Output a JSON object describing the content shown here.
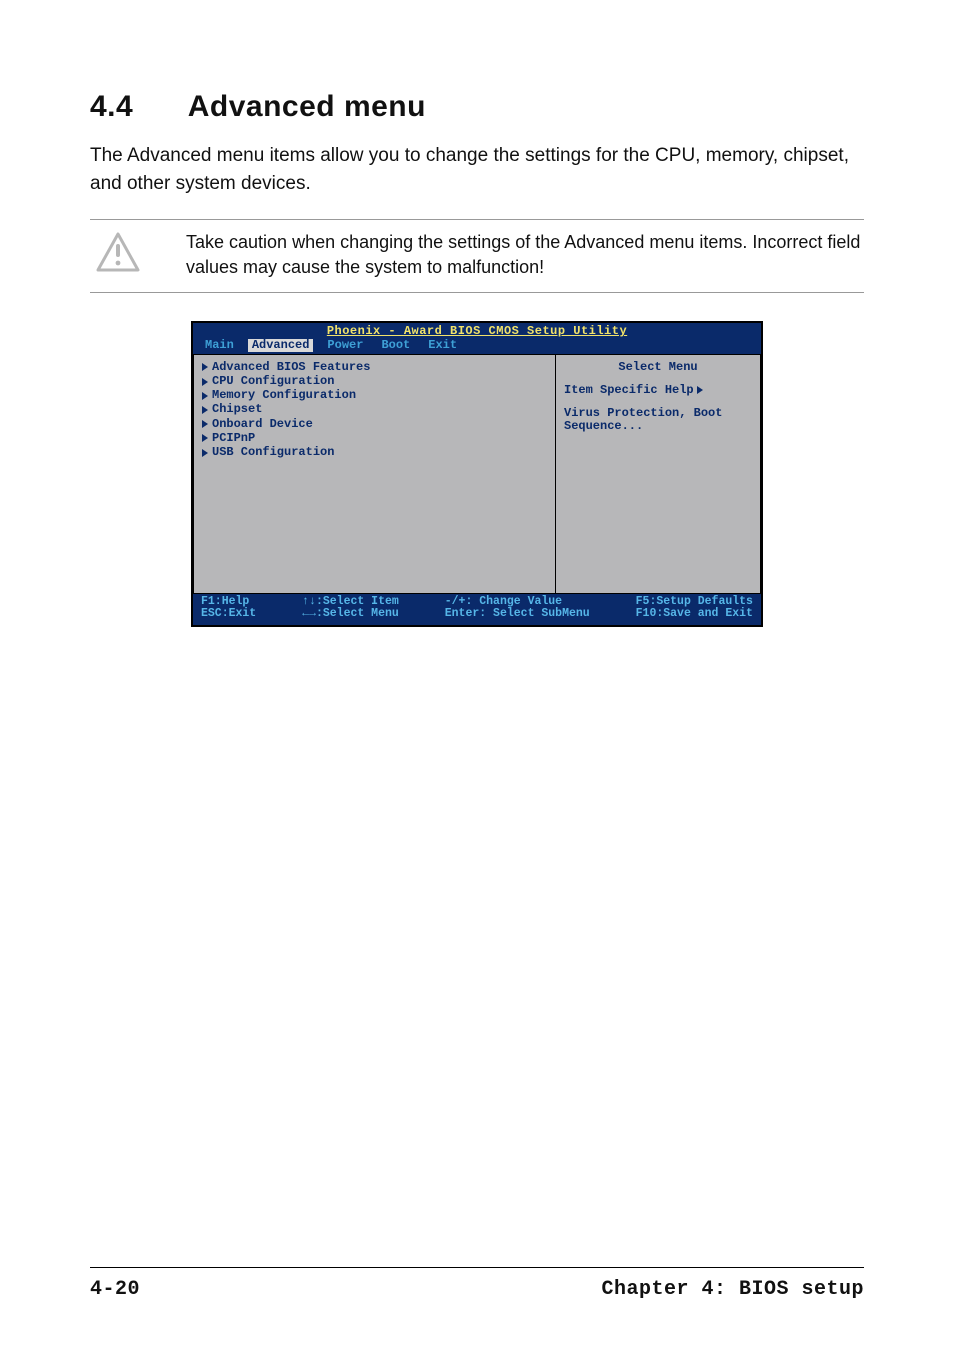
{
  "section": {
    "number": "4.4",
    "title": "Advanced menu",
    "intro": "The Advanced menu items allow you to change the settings for the CPU, memory, chipset, and other system devices.",
    "caution": "Take caution when changing the settings of the Advanced menu items. Incorrect field values may cause the system to malfunction!"
  },
  "bios": {
    "title": "Phoenix - Award BIOS CMOS Setup Utility",
    "tabs": [
      "Main",
      "Advanced",
      "Power",
      "Boot",
      "Exit"
    ],
    "selected_tab": "Advanced",
    "menu_items": [
      "Advanced BIOS Features",
      "CPU Configuration",
      "Memory Configuration",
      "Chipset",
      "Onboard Device",
      "PCIPnP",
      "USB Configuration"
    ],
    "right_title": "Select Menu",
    "help_label": "Item Specific Help",
    "help_text": "Virus Protection, Boot Sequence...",
    "footer": {
      "c1a": "F1:Help",
      "c1b": "ESC:Exit",
      "c2a": "↑↓:Select Item",
      "c2b": "←→:Select Menu",
      "c3a": "-/+: Change Value",
      "c3b": "Enter: Select SubMenu",
      "c4a": "F5:Setup Defaults",
      "c4b": "F10:Save and Exit"
    }
  },
  "footer": {
    "page": "4-20",
    "chapter": "Chapter 4: BIOS setup"
  }
}
